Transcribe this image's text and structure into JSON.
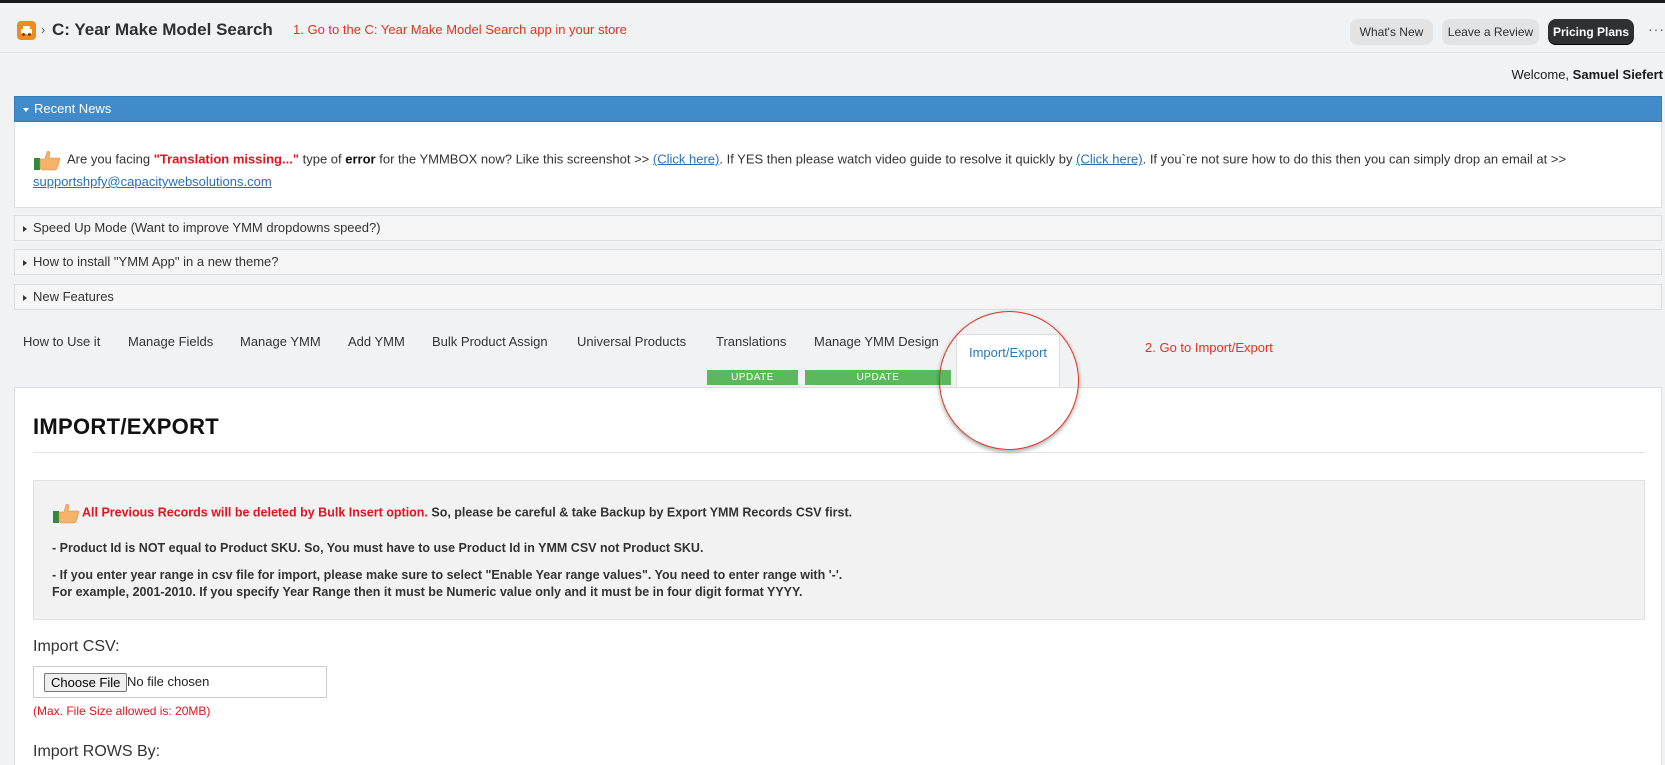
{
  "header": {
    "app_title": "C: Year Make Model Search",
    "crumb_separator": "›",
    "annotation": "1. Go to the C: Year Make Model Search app in your store",
    "buttons": {
      "whats_new": "What's New",
      "leave_review": "Leave a Review",
      "pricing": "Pricing Plans"
    },
    "more": "···"
  },
  "welcome": {
    "prefix": "Welcome,",
    "user": "Samuel Siefert"
  },
  "news": {
    "title": "Recent News",
    "text1": "Are you facing",
    "highlight": "\"Translation missing...\"",
    "text2": "type of",
    "bold_error": "error",
    "text3": "for the YMMBOX now? Like this screenshot >>",
    "link1": "(Click here)",
    "text4": ". If YES then please watch video guide to resolve it quickly by",
    "link2": "(Click here)",
    "text5": ". If you`re not sure how to do this then you can simply drop an email at >>",
    "email": "supportshpfy@capacitywebsolutions.com"
  },
  "panels": [
    {
      "title": "Speed Up Mode (Want to improve YMM dropdowns speed?)"
    },
    {
      "title": "How to install \"YMM App\" in a new theme?"
    },
    {
      "title": "New Features"
    }
  ],
  "tabs": [
    {
      "label": "How to Use it"
    },
    {
      "label": "Manage Fields"
    },
    {
      "label": "Manage YMM"
    },
    {
      "label": "Add YMM"
    },
    {
      "label": "Bulk Product Assign"
    },
    {
      "label": "Universal Products"
    },
    {
      "label": "Translations"
    },
    {
      "label": "Manage YMM Design"
    },
    {
      "label": "Import/Export"
    }
  ],
  "badges": [
    "UPDATE",
    "UPDATE"
  ],
  "annotation2": "2. Go to Import/Export",
  "content": {
    "title": "IMPORT/EXPORT",
    "notice": {
      "warning_red": "All Previous Records will be deleted by Bulk Insert option.",
      "warning_rest": " So, please be careful & take Backup by Export YMM Records CSV first.",
      "line2": "- Product Id is NOT equal to Product SKU. So, You must have to use Product Id in YMM CSV not Product SKU.",
      "line3": "- If you enter year range in csv file for import, please make sure to select \"Enable Year range values\". You need to enter range with '-'.",
      "line4": "For example, 2001-2010. If you specify Year Range then it must be Numeric value only and it must be in four digit format YYYY."
    },
    "import_csv_label": "Import CSV:",
    "choose_file": "Choose File",
    "file_status": "No file chosen",
    "max_size": "(Max. File Size allowed is: 20MB)",
    "import_rows_label": "Import ROWS By:"
  },
  "colors": {
    "accent_blue": "#428bca",
    "badge_green": "#5cb85c",
    "annotation_red": "#e0321f",
    "warning_red": "#e0141e"
  }
}
